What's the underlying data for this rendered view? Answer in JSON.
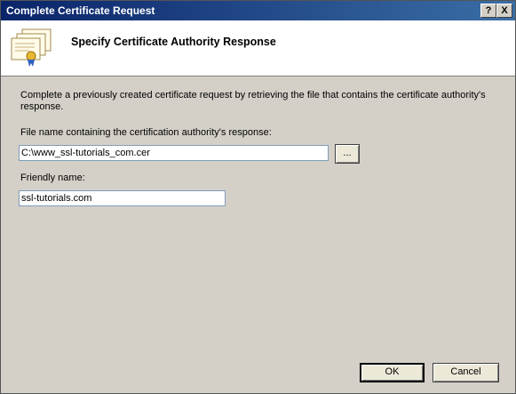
{
  "window": {
    "title": "Complete Certificate Request",
    "help_label": "?",
    "close_label": "X"
  },
  "header": {
    "title": "Specify Certificate Authority Response",
    "icon": "certificate-icon"
  },
  "description": "Complete a previously created certificate request by retrieving the file that contains the certificate authority's response.",
  "file_field": {
    "label": "File name containing the certification authority's response:",
    "value": "C:\\www_ssl-tutorials_com.cer",
    "browse_label": "..."
  },
  "friendly_field": {
    "label": "Friendly name:",
    "value": "ssl-tutorials.com"
  },
  "footer": {
    "ok_label": "OK",
    "cancel_label": "Cancel"
  }
}
